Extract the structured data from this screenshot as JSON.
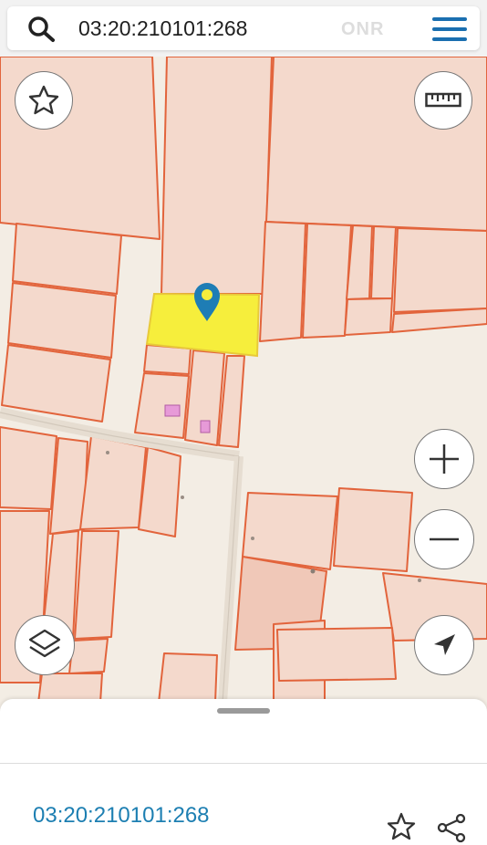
{
  "search": {
    "query": "03:20:210101:268",
    "icon": "search-icon"
  },
  "watermark": "ONR",
  "toolbar": {
    "menu_icon": "hamburger-menu-icon"
  },
  "map_controls": {
    "favorite_icon": "star-icon",
    "ruler_icon": "ruler-icon",
    "zoom_in_icon": "plus-icon",
    "zoom_out_icon": "minus-icon",
    "layers_icon": "layers-icon",
    "locate_icon": "navigation-arrow-icon"
  },
  "selected_parcel": {
    "highlight_color": "#f6ee3c",
    "marker_color": "#1e7db5"
  },
  "colors": {
    "parcel_fill": "#f4d9cc",
    "parcel_border": "#e2643c",
    "building_fill": "#e79ad8",
    "accent": "#1a6fb0"
  },
  "bottom_sheet": {
    "cadastral_number": "03:20:210101:268",
    "star_icon": "star-outline-icon",
    "share_icon": "share-icon"
  }
}
